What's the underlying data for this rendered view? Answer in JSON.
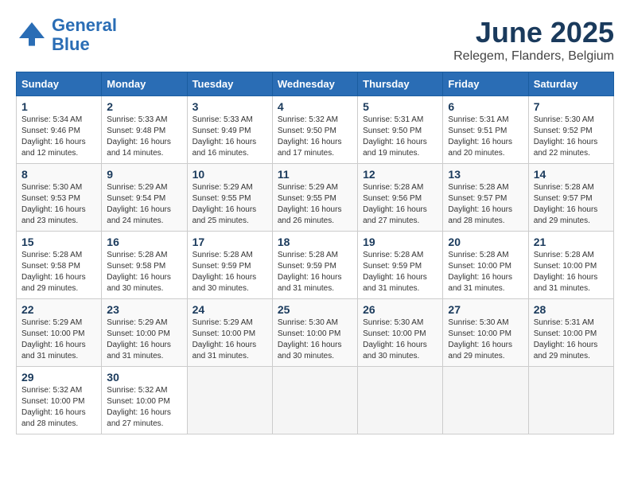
{
  "header": {
    "logo_line1": "General",
    "logo_line2": "Blue",
    "month": "June 2025",
    "location": "Relegem, Flanders, Belgium"
  },
  "weekdays": [
    "Sunday",
    "Monday",
    "Tuesday",
    "Wednesday",
    "Thursday",
    "Friday",
    "Saturday"
  ],
  "weeks": [
    [
      {
        "day": "1",
        "sunrise": "Sunrise: 5:34 AM",
        "sunset": "Sunset: 9:46 PM",
        "daylight": "Daylight: 16 hours and 12 minutes."
      },
      {
        "day": "2",
        "sunrise": "Sunrise: 5:33 AM",
        "sunset": "Sunset: 9:48 PM",
        "daylight": "Daylight: 16 hours and 14 minutes."
      },
      {
        "day": "3",
        "sunrise": "Sunrise: 5:33 AM",
        "sunset": "Sunset: 9:49 PM",
        "daylight": "Daylight: 16 hours and 16 minutes."
      },
      {
        "day": "4",
        "sunrise": "Sunrise: 5:32 AM",
        "sunset": "Sunset: 9:50 PM",
        "daylight": "Daylight: 16 hours and 17 minutes."
      },
      {
        "day": "5",
        "sunrise": "Sunrise: 5:31 AM",
        "sunset": "Sunset: 9:50 PM",
        "daylight": "Daylight: 16 hours and 19 minutes."
      },
      {
        "day": "6",
        "sunrise": "Sunrise: 5:31 AM",
        "sunset": "Sunset: 9:51 PM",
        "daylight": "Daylight: 16 hours and 20 minutes."
      },
      {
        "day": "7",
        "sunrise": "Sunrise: 5:30 AM",
        "sunset": "Sunset: 9:52 PM",
        "daylight": "Daylight: 16 hours and 22 minutes."
      }
    ],
    [
      {
        "day": "8",
        "sunrise": "Sunrise: 5:30 AM",
        "sunset": "Sunset: 9:53 PM",
        "daylight": "Daylight: 16 hours and 23 minutes."
      },
      {
        "day": "9",
        "sunrise": "Sunrise: 5:29 AM",
        "sunset": "Sunset: 9:54 PM",
        "daylight": "Daylight: 16 hours and 24 minutes."
      },
      {
        "day": "10",
        "sunrise": "Sunrise: 5:29 AM",
        "sunset": "Sunset: 9:55 PM",
        "daylight": "Daylight: 16 hours and 25 minutes."
      },
      {
        "day": "11",
        "sunrise": "Sunrise: 5:29 AM",
        "sunset": "Sunset: 9:55 PM",
        "daylight": "Daylight: 16 hours and 26 minutes."
      },
      {
        "day": "12",
        "sunrise": "Sunrise: 5:28 AM",
        "sunset": "Sunset: 9:56 PM",
        "daylight": "Daylight: 16 hours and 27 minutes."
      },
      {
        "day": "13",
        "sunrise": "Sunrise: 5:28 AM",
        "sunset": "Sunset: 9:57 PM",
        "daylight": "Daylight: 16 hours and 28 minutes."
      },
      {
        "day": "14",
        "sunrise": "Sunrise: 5:28 AM",
        "sunset": "Sunset: 9:57 PM",
        "daylight": "Daylight: 16 hours and 29 minutes."
      }
    ],
    [
      {
        "day": "15",
        "sunrise": "Sunrise: 5:28 AM",
        "sunset": "Sunset: 9:58 PM",
        "daylight": "Daylight: 16 hours and 29 minutes."
      },
      {
        "day": "16",
        "sunrise": "Sunrise: 5:28 AM",
        "sunset": "Sunset: 9:58 PM",
        "daylight": "Daylight: 16 hours and 30 minutes."
      },
      {
        "day": "17",
        "sunrise": "Sunrise: 5:28 AM",
        "sunset": "Sunset: 9:59 PM",
        "daylight": "Daylight: 16 hours and 30 minutes."
      },
      {
        "day": "18",
        "sunrise": "Sunrise: 5:28 AM",
        "sunset": "Sunset: 9:59 PM",
        "daylight": "Daylight: 16 hours and 31 minutes."
      },
      {
        "day": "19",
        "sunrise": "Sunrise: 5:28 AM",
        "sunset": "Sunset: 9:59 PM",
        "daylight": "Daylight: 16 hours and 31 minutes."
      },
      {
        "day": "20",
        "sunrise": "Sunrise: 5:28 AM",
        "sunset": "Sunset: 10:00 PM",
        "daylight": "Daylight: 16 hours and 31 minutes."
      },
      {
        "day": "21",
        "sunrise": "Sunrise: 5:28 AM",
        "sunset": "Sunset: 10:00 PM",
        "daylight": "Daylight: 16 hours and 31 minutes."
      }
    ],
    [
      {
        "day": "22",
        "sunrise": "Sunrise: 5:29 AM",
        "sunset": "Sunset: 10:00 PM",
        "daylight": "Daylight: 16 hours and 31 minutes."
      },
      {
        "day": "23",
        "sunrise": "Sunrise: 5:29 AM",
        "sunset": "Sunset: 10:00 PM",
        "daylight": "Daylight: 16 hours and 31 minutes."
      },
      {
        "day": "24",
        "sunrise": "Sunrise: 5:29 AM",
        "sunset": "Sunset: 10:00 PM",
        "daylight": "Daylight: 16 hours and 31 minutes."
      },
      {
        "day": "25",
        "sunrise": "Sunrise: 5:30 AM",
        "sunset": "Sunset: 10:00 PM",
        "daylight": "Daylight: 16 hours and 30 minutes."
      },
      {
        "day": "26",
        "sunrise": "Sunrise: 5:30 AM",
        "sunset": "Sunset: 10:00 PM",
        "daylight": "Daylight: 16 hours and 30 minutes."
      },
      {
        "day": "27",
        "sunrise": "Sunrise: 5:30 AM",
        "sunset": "Sunset: 10:00 PM",
        "daylight": "Daylight: 16 hours and 29 minutes."
      },
      {
        "day": "28",
        "sunrise": "Sunrise: 5:31 AM",
        "sunset": "Sunset: 10:00 PM",
        "daylight": "Daylight: 16 hours and 29 minutes."
      }
    ],
    [
      {
        "day": "29",
        "sunrise": "Sunrise: 5:32 AM",
        "sunset": "Sunset: 10:00 PM",
        "daylight": "Daylight: 16 hours and 28 minutes."
      },
      {
        "day": "30",
        "sunrise": "Sunrise: 5:32 AM",
        "sunset": "Sunset: 10:00 PM",
        "daylight": "Daylight: 16 hours and 27 minutes."
      },
      null,
      null,
      null,
      null,
      null
    ]
  ]
}
